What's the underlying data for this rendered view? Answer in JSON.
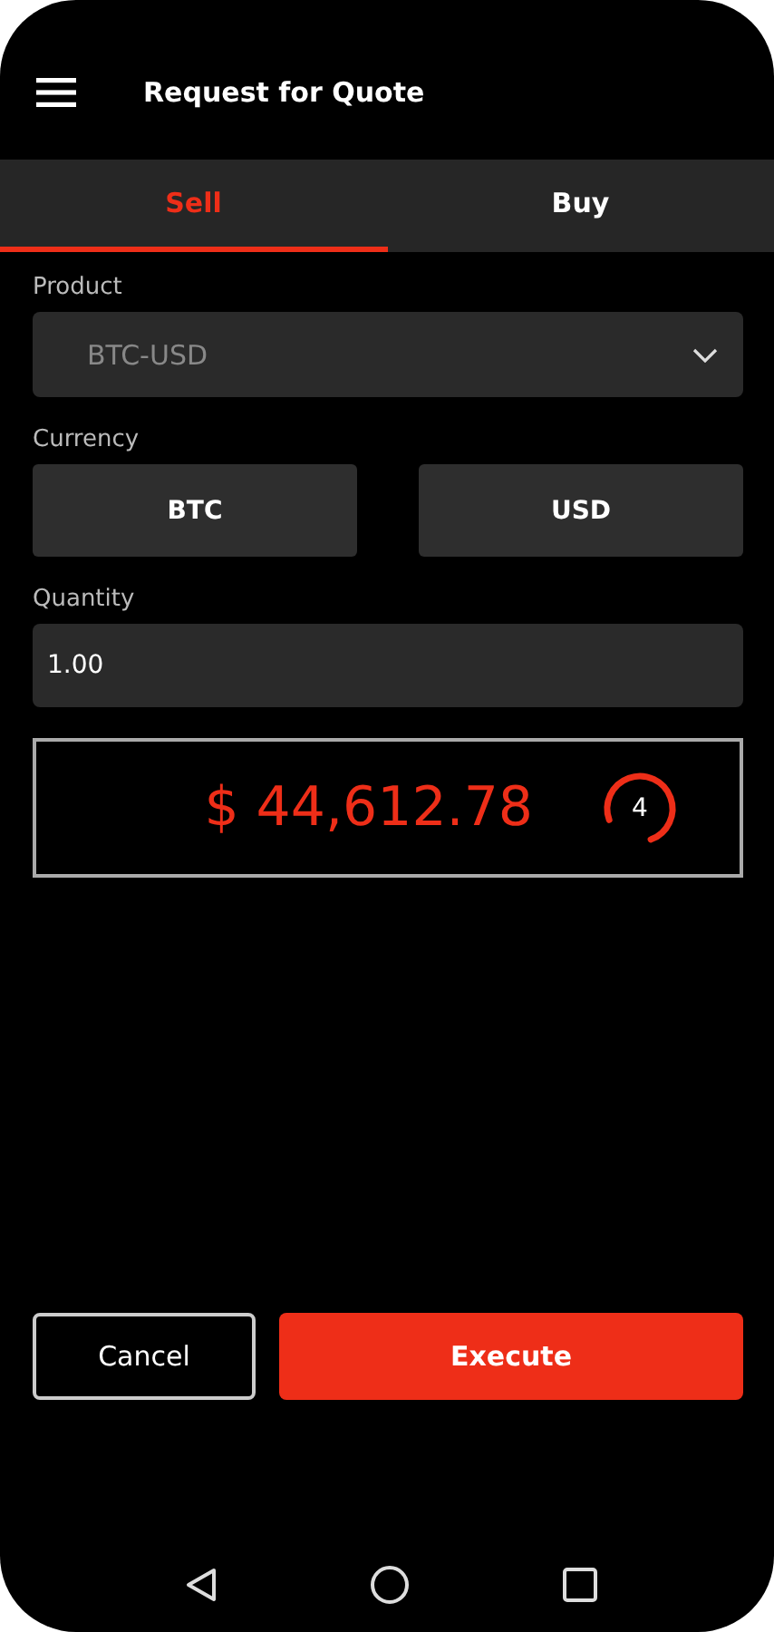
{
  "app_bar": {
    "title": "Request for Quote"
  },
  "tabs": [
    {
      "label": "Sell",
      "selected": true
    },
    {
      "label": "Buy",
      "selected": false
    }
  ],
  "product": {
    "label": "Product",
    "value": "BTC-USD"
  },
  "currency": {
    "label": "Currency",
    "options": [
      {
        "label": "BTC"
      },
      {
        "label": "USD"
      }
    ]
  },
  "quantity": {
    "label": "Quantity",
    "value": "1.00"
  },
  "quote": {
    "price": "$ 44,612.78",
    "countdown": "4",
    "level": 0.75
  },
  "buttons": [
    {
      "label": "Cancel",
      "kind": "outline"
    },
    {
      "label": "Execute",
      "kind": "primary"
    }
  ]
}
